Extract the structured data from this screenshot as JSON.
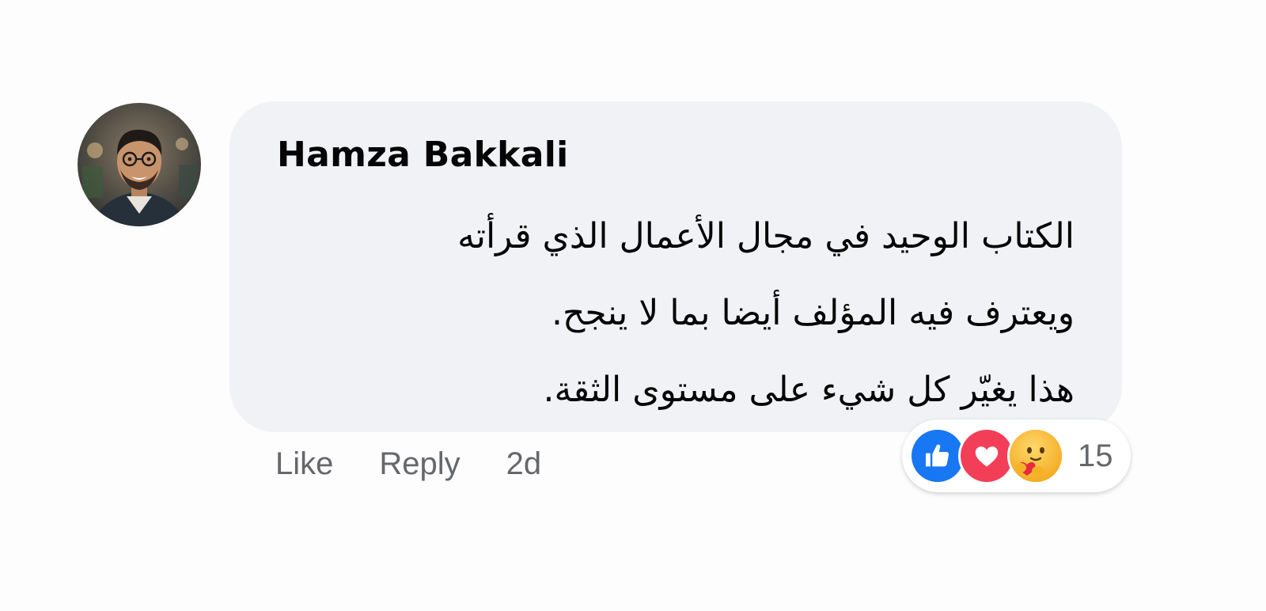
{
  "comment": {
    "author": "Hamza Bakkali",
    "text_lines": [
      "الكتاب الوحيد في مجال الأعمال الذي قرأته",
      "ويعترف فيه المؤلف أيضا بما لا ينجح.",
      "هذا يغيّر كل شيء على مستوى الثقة."
    ]
  },
  "actions": {
    "like": "Like",
    "reply": "Reply",
    "timestamp": "2d"
  },
  "reactions": {
    "icons": [
      "like-icon",
      "love-icon",
      "care-icon"
    ],
    "count": "15"
  },
  "colors": {
    "bubble": "#f0f2f5",
    "like_blue": "#1877f2",
    "love_red": "#f33e58",
    "care_yellow": "#f7b125",
    "muted_text": "#65676b"
  }
}
